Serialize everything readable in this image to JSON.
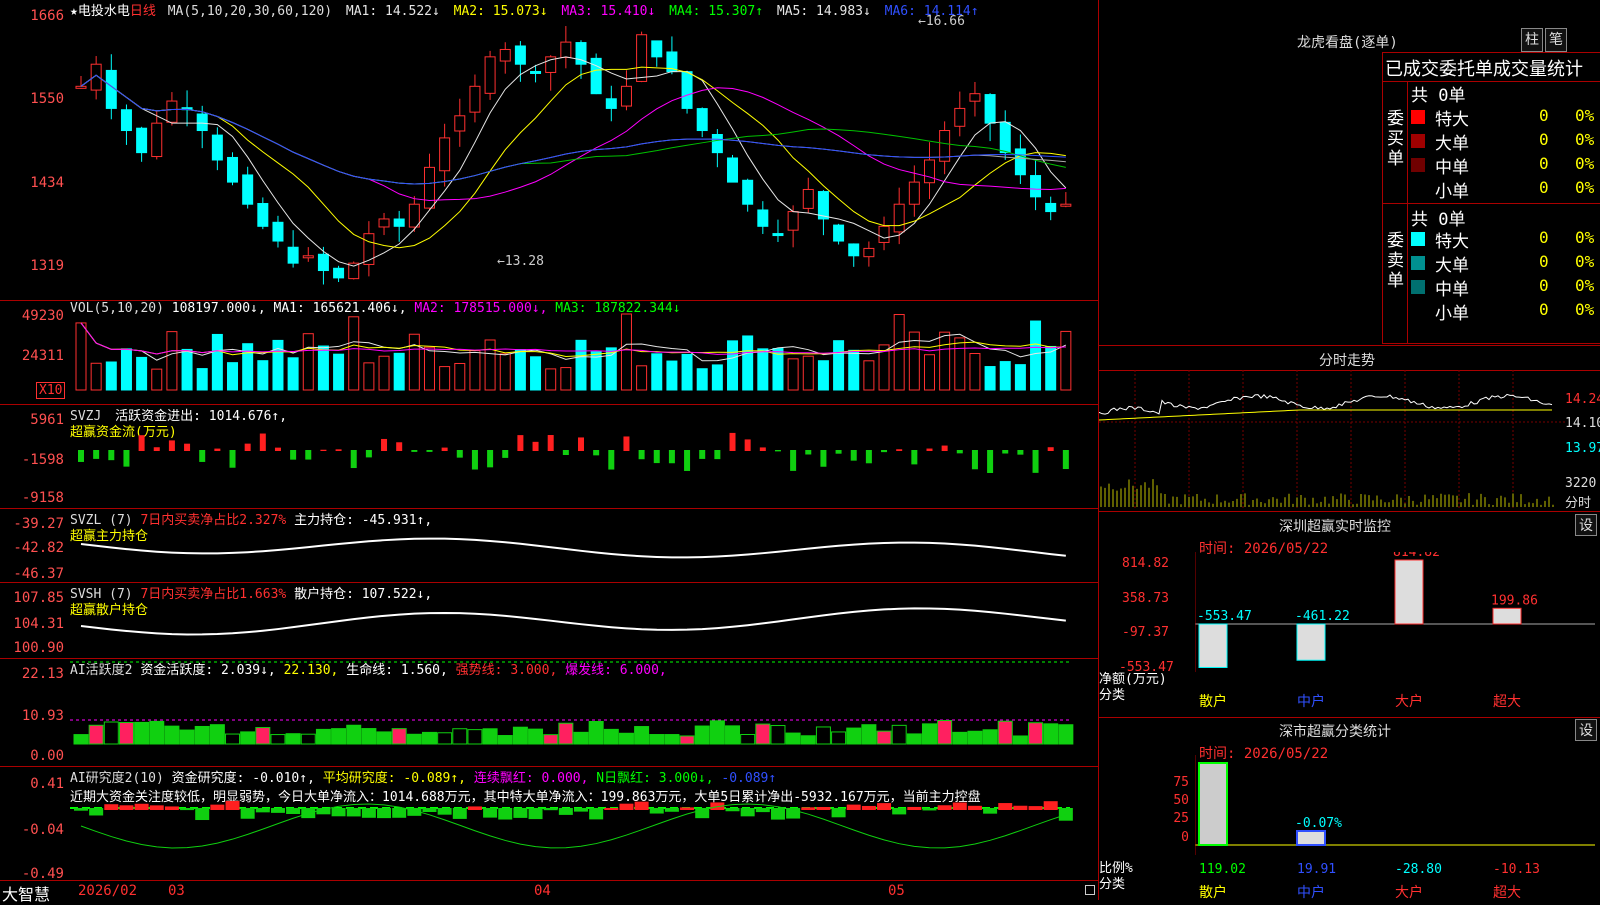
{
  "header": {
    "star": "★",
    "stock_name": "电投水电",
    "period": "日线",
    "ma_def": "MA(5,10,20,30,60,120)",
    "ma_values": [
      {
        "label": "MA1: 14.522↓",
        "color": "#e6e6e6"
      },
      {
        "label": "MA2: 15.073↓",
        "color": "#ffff00"
      },
      {
        "label": "MA3: 15.410↓",
        "color": "#ff00ff"
      },
      {
        "label": "MA4: 15.307↑",
        "color": "#00ff00"
      },
      {
        "label": "MA5: 14.983↓",
        "color": "#e6e6e6"
      },
      {
        "label": "MA6: 14.114↑",
        "color": "#3050ff"
      }
    ],
    "high_marker": "←16.66",
    "low_marker": "←13.28"
  },
  "price_axis": [
    "1666",
    "1550",
    "1434",
    "1319"
  ],
  "vol": {
    "header_prefix": "VOL(5,10,20)",
    "value": "108197.000↓,",
    "ma1": "MA1: 165621.406↓,",
    "ma2": "MA2: 178515.000↓,",
    "ma3": "MA3: 187822.344↓",
    "axis": [
      "49230",
      "24311"
    ],
    "unit": "X10"
  },
  "svzj": {
    "header": "SVZJ",
    "title": "活跃资金进出: 1014.676↑,",
    "sub": "超赢资金流(万元)",
    "axis": [
      "5961",
      "-1598",
      "-9158"
    ]
  },
  "svzl": {
    "header": "SVZL (7)",
    "desc": "7日内买卖净占比2.327%",
    "value": "主力持仓: -45.931↑,",
    "sub": "超赢主力持仓",
    "axis": [
      "-39.27",
      "-42.82",
      "-46.37"
    ]
  },
  "svsh": {
    "header": "SVSH (7)",
    "desc": "7日内买卖净占比1.663%",
    "value": "散户持仓: 107.522↓,",
    "sub": "超赢散户持仓",
    "axis": [
      "107.85",
      "104.31",
      "100.90"
    ]
  },
  "ai1": {
    "header": "AI活跃度2",
    "v1": "资金活跃度: 2.039↓,",
    "v2": "22.130,",
    "v3": "生命线: 1.560,",
    "v4": "强势线: 3.000,",
    "v5": "爆发线: 6.000,",
    "axis": [
      "22.13",
      "10.93",
      "0.00"
    ]
  },
  "ai2": {
    "header": "AI研究度2(10)",
    "v1": "资金研究度: -0.010↑,",
    "v2": "平均研究度: -0.089↑,",
    "v3": "连续飘红: 0.000,",
    "v4": "N日飘红: 3.000↓,",
    "v5": "-0.089↑",
    "text": "近期大资金关注度较低，明显弱势，今日大单净流入：1014.688万元，其中特大单净流入：199.863万元，大单5日累计净出-5932.167万元，当前主力控盘",
    "axis": [
      "0.41",
      "-0.04",
      "-0.49"
    ]
  },
  "bottom": {
    "brand": "大智慧",
    "dates": [
      "2026/02",
      "03",
      "04",
      "05"
    ]
  },
  "right": {
    "title": "龙虎看盘(逐单)",
    "btn1": "柱",
    "btn2": "笔",
    "subtitle": "已成交委托单成交量统计",
    "buy_label": "委买单",
    "sell_label": "委卖单",
    "buy_total": "共 0单",
    "sell_total": "共 0单",
    "buy_rows": [
      {
        "name": "特大",
        "count": "0",
        "pct": "0%",
        "color": "#ff0000"
      },
      {
        "name": "大单",
        "count": "0",
        "pct": "0%",
        "color": "#a00000"
      },
      {
        "name": "中单",
        "count": "0",
        "pct": "0%",
        "color": "#700000"
      },
      {
        "name": "小单",
        "count": "0",
        "pct": "0%",
        "color": ""
      }
    ],
    "sell_rows": [
      {
        "name": "特大",
        "count": "0",
        "pct": "0%",
        "color": "#00ffff"
      },
      {
        "name": "大单",
        "count": "0",
        "pct": "0%",
        "color": "#009090"
      },
      {
        "name": "中单",
        "count": "0",
        "pct": "0%",
        "color": "#007070"
      },
      {
        "name": "小单",
        "count": "0",
        "pct": "0%",
        "color": ""
      }
    ],
    "intraday_title": "分时走势",
    "intraday_axis": [
      "14.24",
      "14.10",
      "13.97"
    ],
    "intraday_vol": "3220",
    "intraday_vol_label": "分时",
    "monitor_title": "深圳超赢实时监控",
    "set_label": "设",
    "monitor_time": "时间: 2026/05/22",
    "monitor_axis": [
      "814.82",
      "358.73",
      "-97.37",
      "-553.47"
    ],
    "monitor_values": [
      "-553.47",
      "-461.22",
      "814.82",
      "199.86"
    ],
    "monitor_yl": "净额(万元)",
    "monitor_xl": "分类",
    "categories": [
      "散户",
      "中户",
      "大户",
      "超大"
    ],
    "class_title": "深市超赢分类统计",
    "class_time": "时间: 2026/05/22",
    "class_axis": [
      "75",
      "50",
      "25",
      "0"
    ],
    "class_annot": "-0.07%",
    "class_values": [
      "119.02",
      "19.91",
      "-28.80",
      "-10.13"
    ],
    "class_yl": "比例%",
    "class_xl": "分类"
  }
}
